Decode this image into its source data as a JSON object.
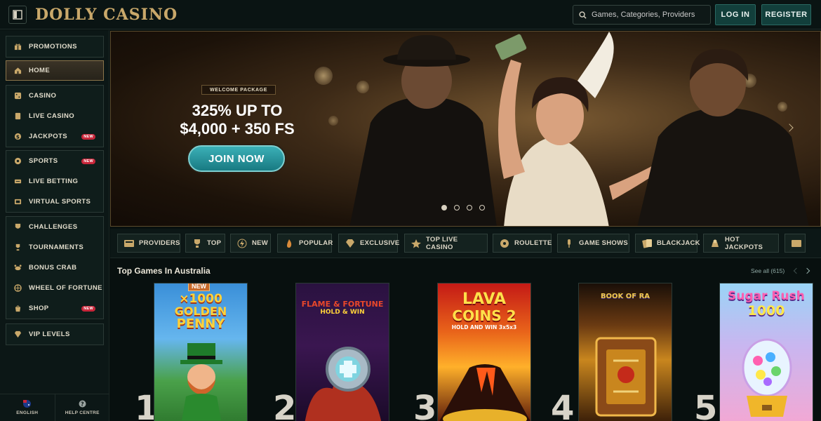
{
  "header": {
    "brand": "DOLLY CASINO",
    "search_placeholder": "Games, Categories, Providers",
    "login_label": "LOG IN",
    "register_label": "REGISTER"
  },
  "sidebar": {
    "groups": [
      [
        {
          "label": "PROMOTIONS",
          "icon": "gift-icon"
        }
      ],
      [
        {
          "label": "HOME",
          "icon": "home-icon",
          "active": true
        }
      ],
      [
        {
          "label": "CASINO",
          "icon": "casino-icon"
        },
        {
          "label": "LIVE CASINO",
          "icon": "live-casino-icon"
        },
        {
          "label": "JACKPOTS",
          "icon": "jackpot-icon",
          "badge": "NEW"
        }
      ],
      [
        {
          "label": "SPORTS",
          "icon": "ball-icon",
          "badge": "NEW"
        },
        {
          "label": "LIVE BETTING",
          "icon": "live-betting-icon"
        },
        {
          "label": "VIRTUAL SPORTS",
          "icon": "virtual-sports-icon"
        }
      ],
      [
        {
          "label": "CHALLENGES",
          "icon": "challenge-icon"
        },
        {
          "label": "TOURNAMENTS",
          "icon": "trophy-icon"
        },
        {
          "label": "BONUS CRAB",
          "icon": "crab-icon"
        },
        {
          "label": "WHEEL OF FORTUNE",
          "icon": "wheel-icon"
        },
        {
          "label": "SHOP",
          "icon": "shop-icon",
          "badge": "NEW"
        }
      ],
      [
        {
          "label": "VIP LEVELS",
          "icon": "diamond-icon"
        }
      ]
    ],
    "bottom": {
      "language": "ENGLISH",
      "help": "HELP CENTRE"
    }
  },
  "hero": {
    "badge": "WELCOME PACKAGE",
    "line1": "325% UP TO",
    "line2": "$4,000 + 350 FS",
    "cta": "JOIN NOW",
    "slides": 4,
    "active_slide": 1
  },
  "categories": [
    {
      "label": "PROVIDERS",
      "icon": "providers-icon"
    },
    {
      "label": "TOP",
      "icon": "trophy-icon"
    },
    {
      "label": "NEW",
      "icon": "lightning-icon"
    },
    {
      "label": "POPULAR",
      "icon": "fire-icon"
    },
    {
      "label": "EXCLUSIVE",
      "icon": "diamond-icon"
    },
    {
      "label": "TOP LIVE CASINO",
      "icon": "star-icon"
    },
    {
      "label": "ROULETTE",
      "icon": "roulette-icon"
    },
    {
      "label": "GAME SHOWS",
      "icon": "microphone-icon"
    },
    {
      "label": "BLACKJACK",
      "icon": "cards-icon"
    },
    {
      "label": "HOT JACKPOTS",
      "icon": "jackpot-icon"
    }
  ],
  "top_games": {
    "title": "Top Games In Australia",
    "see_all": "See all (615)",
    "games": [
      {
        "rank": "1",
        "title_a": "×1000",
        "title_b": "GOLDEN",
        "title_c": "PENNY",
        "tag": "NEW"
      },
      {
        "rank": "2",
        "title_a": "FLAME & FORTUNE",
        "title_b": "HOLD & WIN",
        "title_c": ""
      },
      {
        "rank": "3",
        "title_a": "LAVA",
        "title_b": "COINS 2",
        "title_c": "HOLD AND WIN 3x5x3"
      },
      {
        "rank": "4",
        "title_a": "BOOK OF RA",
        "title_b": "",
        "title_c": ""
      },
      {
        "rank": "5",
        "title_a": "Sugar Rush",
        "title_b": "1000",
        "title_c": ""
      }
    ]
  },
  "colors": {
    "accent": "#1f7f87",
    "gold": "#c9a86a",
    "badge_red": "#c8263a",
    "bg": "#08100f"
  }
}
